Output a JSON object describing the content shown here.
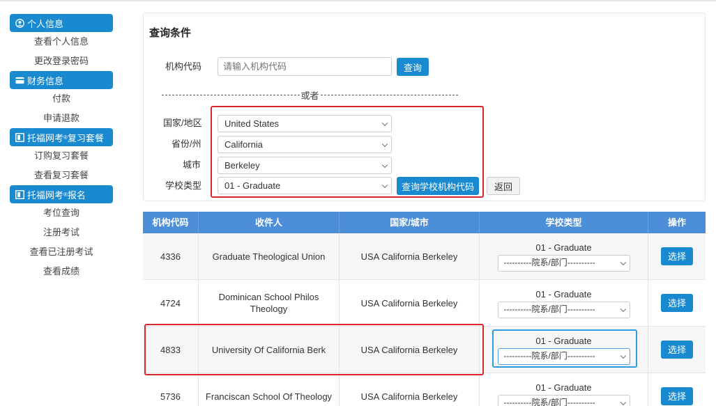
{
  "sidebar": {
    "sections": [
      {
        "title": "个人信息",
        "icon": "user-circle-icon",
        "items": [
          "查看个人信息",
          "更改登录密码"
        ]
      },
      {
        "title": "财务信息",
        "icon": "credit-card-icon",
        "items": [
          "付款",
          "申请退款"
        ]
      },
      {
        "title_pre": "托福网考",
        "title_sup": "®",
        "title_post": "复习套餐",
        "icon": "book-icon",
        "items": [
          "订购复习套餐",
          "查看复习套餐"
        ]
      },
      {
        "title_pre": "托福网考",
        "title_sup": "®",
        "title_post": "报名",
        "icon": "book-icon",
        "items": [
          "考位查询",
          "注册考试",
          "查看已注册考试",
          "查看成绩"
        ]
      }
    ]
  },
  "query": {
    "title": "查询条件",
    "code_label": "机构代码",
    "code_placeholder": "请输入机构代码",
    "search_button": "查询",
    "or_text": "或者",
    "country_label": "国家/地区",
    "country_value": "United States",
    "state_label": "省份/州",
    "state_value": "California",
    "city_label": "城市",
    "city_value": "Berkeley",
    "school_type_label": "学校类型",
    "school_type_value": "01 - Graduate",
    "lookup_button": "查询学校机构代码",
    "back_button": "返回"
  },
  "table": {
    "headers": [
      "机构代码",
      "收件人",
      "国家/城市",
      "学校类型",
      "操作"
    ],
    "rows": [
      {
        "code": "4336",
        "recipient": "Graduate Theological Union",
        "location": "USA California Berkeley",
        "type": "01 - Graduate",
        "dept": "----------院系/部门----------",
        "action": "选择"
      },
      {
        "code": "4724",
        "recipient": "Dominican School Philos Theology",
        "location": "USA California Berkeley",
        "type": "01 - Graduate",
        "dept": "----------院系/部门----------",
        "action": "选择"
      },
      {
        "code": "4833",
        "recipient": "University Of California Berk",
        "location": "USA California Berkeley",
        "type": "01 - Graduate",
        "dept": "----------院系/部门----------",
        "action": "选择"
      },
      {
        "code": "5736",
        "recipient": "Franciscan School Of Theology",
        "location": "USA California Berkeley",
        "type": "01 - Graduate",
        "dept": "----------院系/部门----------",
        "action": "选择"
      }
    ]
  },
  "colors": {
    "accent": "#1a8ad0",
    "table_header": "#4c8fd8",
    "highlight_red": "#d9272e",
    "highlight_blue": "#2e9ae0"
  }
}
